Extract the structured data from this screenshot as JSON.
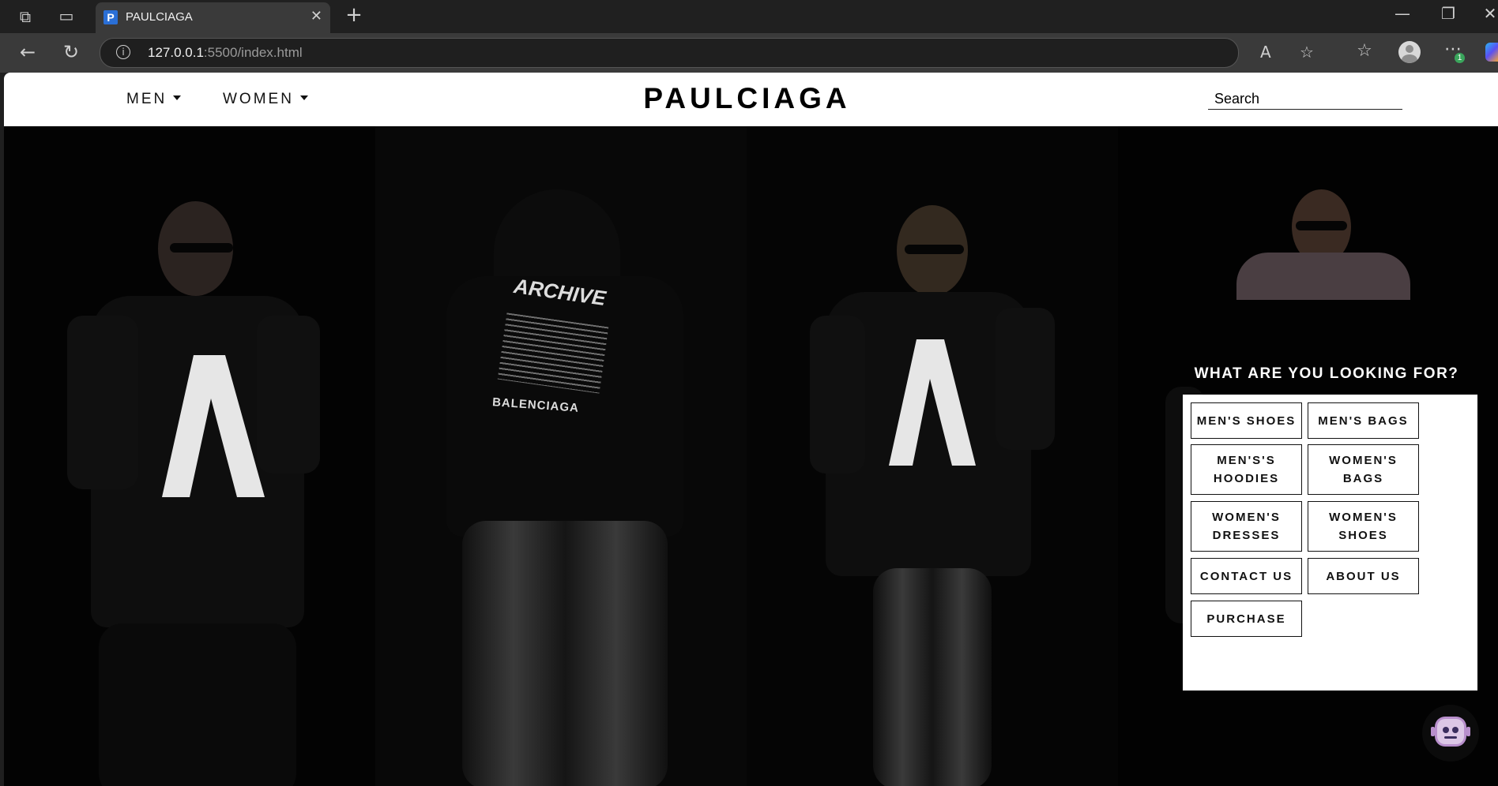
{
  "browser": {
    "tab_title": "PAULCIAGA",
    "tab_favicon_letter": "P",
    "url_host": "127.0.0.1",
    "url_path": ":5500/index.html",
    "notification_count": "1"
  },
  "site": {
    "logo": "PAULCIAGA",
    "nav": [
      {
        "label": "MEN"
      },
      {
        "label": "WOMEN"
      }
    ],
    "search_placeholder": "Search"
  },
  "hero": {
    "print_archive": "ARCHIVE",
    "print_brand": "BALENCIAGA"
  },
  "popup": {
    "title": "WHAT ARE YOU LOOKING FOR?",
    "options": [
      {
        "label": "MEN'S SHOES"
      },
      {
        "label": "MEN'S BAGS"
      },
      {
        "label": "MEN'S'S HOODIES"
      },
      {
        "label": "WOMEN'S BAGS"
      },
      {
        "label": "WOMEN'S DRESSES"
      },
      {
        "label": "WOMEN'S SHOES"
      },
      {
        "label": "CONTACT US"
      },
      {
        "label": "ABOUT US"
      },
      {
        "label": "PURCHASE"
      }
    ]
  },
  "colors": {
    "header_bg": "#ffffff",
    "hero_bg": "#000000",
    "accent": "#111111"
  }
}
